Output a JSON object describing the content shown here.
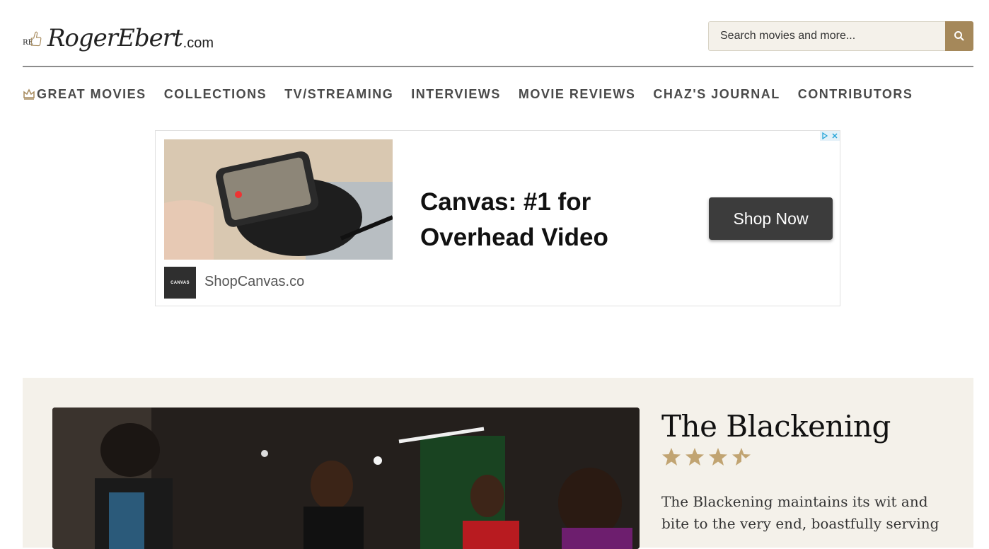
{
  "header": {
    "logo_monogram": "RE",
    "logo_name": "RogerEbert",
    "logo_tld": ".com",
    "search_placeholder": "Search movies and more..."
  },
  "nav": {
    "items": [
      {
        "label": "GREAT MOVIES",
        "icon": "crown-icon"
      },
      {
        "label": "COLLECTIONS"
      },
      {
        "label": "TV/STREAMING"
      },
      {
        "label": "INTERVIEWS"
      },
      {
        "label": "MOVIE REVIEWS"
      },
      {
        "label": "CHAZ'S JOURNAL"
      },
      {
        "label": "CONTRIBUTORS"
      }
    ]
  },
  "ad": {
    "headline": "Canvas: #1 for Overhead Video",
    "cta": "Shop Now",
    "brand_logo_text": "CANVAS",
    "domain": "ShopCanvas.co"
  },
  "feature": {
    "title": "The Blackening",
    "rating": 3.5,
    "rating_max": 4,
    "description": "The Blackening maintains its wit and bite to the very end, boastfully serving"
  },
  "colors": {
    "accent": "#a5885a",
    "feature_bg": "#f4f1ea",
    "star": "#c1a472"
  }
}
